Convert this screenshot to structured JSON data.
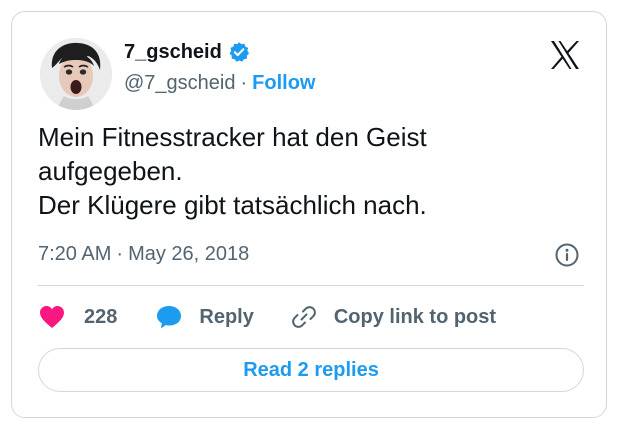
{
  "author": {
    "name": "7_gscheid",
    "handle": "@7_gscheid",
    "separator": "·",
    "follow_label": "Follow",
    "verified": true
  },
  "tweet": {
    "lines": [
      "Mein Fitnesstracker hat den Geist",
      "aufgegeben.",
      "Der Klügere gibt tatsächlich nach."
    ]
  },
  "meta": {
    "time": "7:20 AM",
    "separator": "·",
    "date": "May 26, 2018"
  },
  "actions": {
    "like_count": "228",
    "reply_label": "Reply",
    "copy_label": "Copy link to post"
  },
  "read_replies_label": "Read 2 replies",
  "colors": {
    "accent": "#1d9bf0",
    "like": "#f91880",
    "text": "#0f1419",
    "secondary": "#536471",
    "border": "#cfd9de"
  },
  "icons": {
    "logo": "x-logo-icon",
    "verified": "verified-badge-icon",
    "info": "info-icon",
    "like": "heart-icon",
    "reply": "speech-bubble-icon",
    "copy": "link-icon"
  }
}
